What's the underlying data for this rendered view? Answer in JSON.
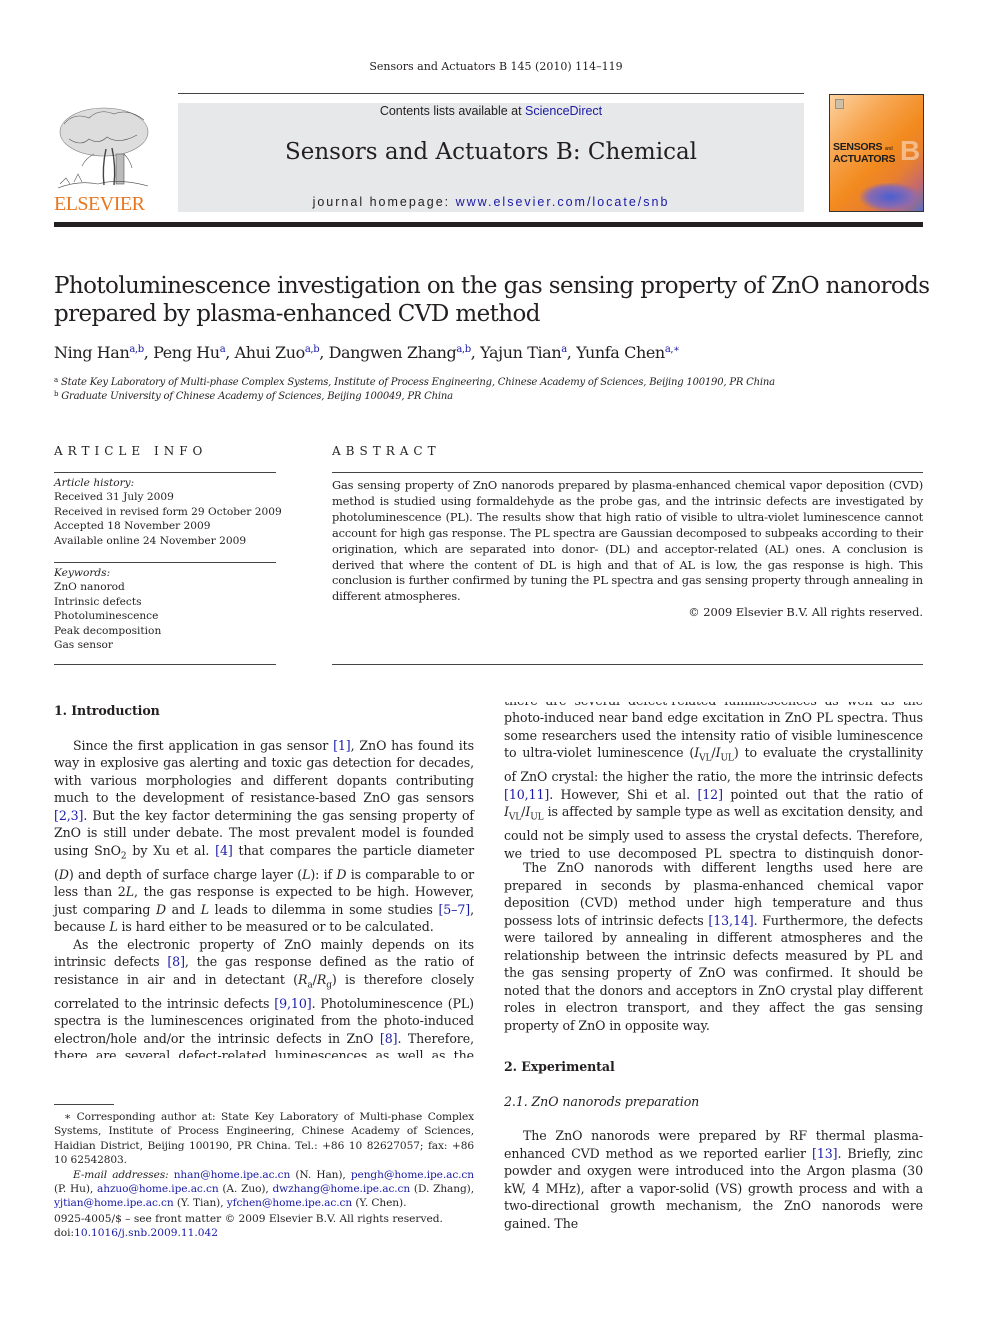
{
  "header": {
    "running_head": "Sensors and Actuators B 145 (2010) 114–119",
    "contents_prefix": "Contents lists available at ",
    "contents_link": "ScienceDirect",
    "journal_title": "Sensors and Actuators B: Chemical",
    "homepage_prefix": "journal homepage: ",
    "homepage_link": "www.elsevier.com/locate/snb",
    "publisher_logo_text": "ELSEVIER",
    "cover": {
      "line1": "SENSORS",
      "line1_small": "and",
      "line2": "ACTUATORS",
      "big_letter": "B"
    },
    "colors": {
      "publisher_orange": "#e87722",
      "link_blue": "#1a1aa6",
      "masthead_gray": "#e7e8e9"
    }
  },
  "article": {
    "title": "Photoluminescence investigation on the gas sensing property of ZnO nanorods prepared by plasma-enhanced CVD method",
    "authors": [
      {
        "name": "Ning Han",
        "sup": "a,b",
        "sep": ", "
      },
      {
        "name": "Peng Hu",
        "sup": "a",
        "sep": ", "
      },
      {
        "name": "Ahui Zuo",
        "sup": "a,b",
        "sep": ", "
      },
      {
        "name": "Dangwen Zhang",
        "sup": "a,b",
        "sep": ", "
      },
      {
        "name": "Yajun Tian",
        "sup": "a",
        "sep": ", "
      },
      {
        "name": "Yunfa Chen",
        "sup": "a,∗",
        "sep": ""
      }
    ],
    "affiliations": [
      {
        "mark": "a",
        "text": "State Key Laboratory of Multi-phase Complex Systems, Institute of Process Engineering, Chinese Academy of Sciences, Beijing 100190, PR China"
      },
      {
        "mark": "b",
        "text": "Graduate University of Chinese Academy of Sciences, Beijing 100049, PR China"
      }
    ]
  },
  "article_info": {
    "heading": "ARTICLE INFO",
    "history_label": "Article history:",
    "history": [
      "Received 31 July 2009",
      "Received in revised form 29 October 2009",
      "Accepted 18 November 2009",
      "Available online 24 November 2009"
    ],
    "keywords_label": "Keywords:",
    "keywords": [
      "ZnO nanorod",
      "Intrinsic defects",
      "Photoluminescence",
      "Peak decomposition",
      "Gas sensor"
    ]
  },
  "abstract": {
    "heading": "ABSTRACT",
    "text": "Gas sensing property of ZnO nanorods prepared by plasma-enhanced chemical vapor deposition (CVD) method is studied using formaldehyde as the probe gas, and the intrinsic defects are investigated by photoluminescence (PL). The results show that high ratio of visible to ultra-violet luminescence cannot account for high gas response. The PL spectra are Gaussian decomposed to subpeaks according to their origination, which are separated into donor- (DL) and acceptor-related (AL) ones. A conclusion is derived that where the content of DL is high and that of AL is low, the gas response is high. This conclusion is further confirmed by tuning the PL spectra and gas sensing property through annealing in different atmospheres.",
    "copyright": "© 2009 Elsevier B.V. All rights reserved."
  },
  "body": {
    "section1_heading": "1.  Introduction",
    "intro_p1": [
      {
        "t": "Since the first application in gas sensor "
      },
      {
        "ref": "[1]"
      },
      {
        "t": ", ZnO has found its way in explosive gas alerting and toxic gas detection for decades, with various morphologies and different dopants contributing much to the development of resistance-based ZnO gas sensors "
      },
      {
        "ref": "[2,3]"
      },
      {
        "t": ". But the key factor determining the gas sensing property of ZnO is still under debate. The most prevalent model is founded using SnO"
      },
      {
        "sub": "2"
      },
      {
        "t": " by Xu et al. "
      },
      {
        "ref": "[4]"
      },
      {
        "t": " that compares the particle diameter ("
      },
      {
        "i": "D"
      },
      {
        "t": ") and depth of surface charge layer ("
      },
      {
        "i": "L"
      },
      {
        "t": "): if "
      },
      {
        "i": "D"
      },
      {
        "t": " is comparable to or less than 2"
      },
      {
        "i": "L"
      },
      {
        "t": ", the gas response is expected to be high. However, just comparing "
      },
      {
        "i": "D"
      },
      {
        "t": " and "
      },
      {
        "i": "L"
      },
      {
        "t": " leads to dilemma in some studies "
      },
      {
        "ref": "[5–7]"
      },
      {
        "t": ", because "
      },
      {
        "i": "L"
      },
      {
        "t": " is hard either to be measured or to be calculated."
      }
    ],
    "intro_p2": [
      {
        "t": "As the electronic property of ZnO mainly depends on its intrinsic defects "
      },
      {
        "ref": "[8]"
      },
      {
        "t": ", the gas response defined as the ratio of resistance in air and in detectant ("
      },
      {
        "i": "R"
      },
      {
        "sub": "a"
      },
      {
        "t": "/"
      },
      {
        "i": "R"
      },
      {
        "sub": "g"
      },
      {
        "t": ") is therefore closely correlated to the intrinsic defects "
      },
      {
        "ref": "[9,10]"
      },
      {
        "t": ". Photoluminescence (PL) spectra is the luminescences originated from the photo-induced electron/hole and/or the intrinsic defects in ZnO "
      },
      {
        "ref": "[8]"
      },
      {
        "t": ". Therefore, there are several defect-related luminescences as well as the photo-induced near band edge excitation in ZnO PL spectra. Thus some researchers used the intensity ratio of visible luminescence to ultra-violet luminescence ("
      },
      {
        "i": "I"
      },
      {
        "sub": "VL"
      },
      {
        "t": "/"
      },
      {
        "i": "I"
      },
      {
        "sub": "UL"
      },
      {
        "t": ") to evaluate the crystallinity of ZnO crystal: the higher the ratio, the more the intrinsic defects "
      },
      {
        "ref": "[10,11]"
      },
      {
        "t": ". However, Shi et al. "
      },
      {
        "ref": "[12]"
      },
      {
        "t": " pointed out that the ratio of "
      },
      {
        "i": "I"
      },
      {
        "sub": "VL"
      },
      {
        "t": "/"
      },
      {
        "i": "I"
      },
      {
        "sub": "UL"
      },
      {
        "t": " is affected by sample type as well as excitation density, and could not be simply used to assess the crystal defects. Therefore, we tried to use decomposed PL spectra to distinguish donor-related (DL) and acceptor-related luminescences (AL) and further to investigate the relationship between the intrinsic defects and the gas sensing property of ZnO."
      }
    ],
    "intro_p3": [
      {
        "t": "The ZnO nanorods with different lengths used here are prepared in seconds by plasma-enhanced chemical vapor deposition (CVD) method under high temperature and thus possess lots of intrinsic defects "
      },
      {
        "ref": "[13,14]"
      },
      {
        "t": ". Furthermore, the defects were tailored by annealing in different atmospheres and the relationship between the intrinsic defects measured by PL and the gas sensing property of ZnO was confirmed. It should be noted that the donors and acceptors in ZnO crystal play different roles in electron transport, and they affect the gas sensing property of ZnO in opposite way."
      }
    ],
    "section2_heading": "2.  Experimental",
    "subsection21_heading": "2.1.  ZnO nanorods preparation",
    "exp_p1": [
      {
        "t": "The ZnO nanorods were prepared by RF thermal plasma-enhanced CVD method as we reported earlier "
      },
      {
        "ref": "[13]"
      },
      {
        "t": ". Briefly, zinc powder and oxygen were introduced into the Argon plasma (30 kW, 4 MHz), after a vapor-solid (VS) growth process and with a two-directional growth mechanism, the ZnO nanorods were gained. The"
      }
    ]
  },
  "footnote": {
    "corresponding": "∗  Corresponding author at: State Key Laboratory of Multi-phase Complex Systems, Institute of Process Engineering, Chinese Academy of Sciences, Haidian District, Beijing 100190, PR China. Tel.: +86 10 82627057; fax: +86 10 62542803.",
    "email_label": "E-mail addresses:",
    "emails": [
      {
        "addr": "nhan@home.ipe.ac.cn",
        "who": " (N. Han), "
      },
      {
        "addr": "pengh@home.ipe.ac.cn",
        "who": " (P. Hu), "
      },
      {
        "addr": "ahzuo@home.ipe.ac.cn",
        "who": " (A. Zuo), "
      },
      {
        "addr": "dwzhang@home.ipe.ac.cn",
        "who": " (D. Zhang), "
      },
      {
        "addr": "yjtian@home.ipe.ac.cn",
        "who": " (Y. Tian), "
      },
      {
        "addr": "yfchen@home.ipe.ac.cn",
        "who": " (Y. Chen)."
      }
    ]
  },
  "frontmatter": {
    "issn_line": "0925-4005/$ – see front matter © 2009 Elsevier B.V. All rights reserved.",
    "doi_prefix": "doi:",
    "doi": "10.1016/j.snb.2009.11.042"
  }
}
